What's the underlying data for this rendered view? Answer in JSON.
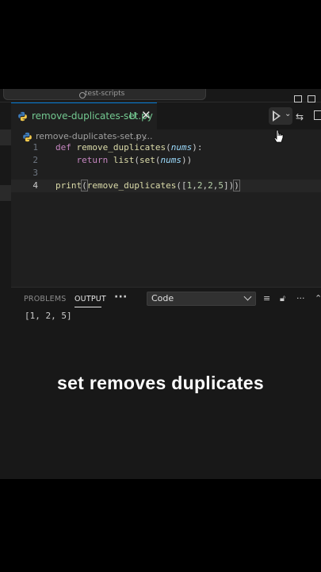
{
  "window": {
    "command_center_label": "test-scripts"
  },
  "editor_tab": {
    "filename": "remove-duplicates-set.py",
    "status": "U",
    "close_glyph": "✕"
  },
  "breadcrumb": {
    "file": "remove-duplicates-set.py",
    "separator": "›",
    "more": "..."
  },
  "code": {
    "line_numbers": [
      "1",
      "2",
      "3",
      "4"
    ],
    "lines": [
      {
        "kw": "def",
        "fn": "remove_duplicates",
        "open": "(",
        "param": "nums",
        "close": "):"
      },
      {
        "kw": "return",
        "fn1": "list",
        "open1": "(",
        "fn2": "set",
        "open2": "(",
        "param": "nums",
        "close": "))"
      },
      {},
      {
        "fn": "print",
        "open": "(",
        "fn2": "remove_duplicates",
        "open2": "([",
        "n1": "1",
        "c1": ",",
        "n2": "2",
        "c2": ",",
        "n3": "2",
        "c3": ",",
        "n4": "5",
        "close": "])",
        "close2": ")"
      }
    ]
  },
  "panel": {
    "tabs": [
      "PROBLEMS",
      "OUTPUT"
    ],
    "active_tab": "OUTPUT",
    "more": "···",
    "output_channel": "Code",
    "output_text": "[1, 2, 5]"
  },
  "caption": "set removes duplicates",
  "colors": {
    "editor_bg": "#1f1f1f",
    "panel_bg": "#181818",
    "untracked_green": "#73c991",
    "accent_blue": "#0078d4",
    "keyword": "#c586c0",
    "function": "#dcdcaa",
    "parameter": "#9cdcfe",
    "number": "#b5cea8"
  },
  "icons": [
    "python-file-icon",
    "run-python-icon",
    "diff-icon",
    "split-editor-icon",
    "clear-output-icon",
    "lock-scroll-icon",
    "more-actions-icon"
  ]
}
